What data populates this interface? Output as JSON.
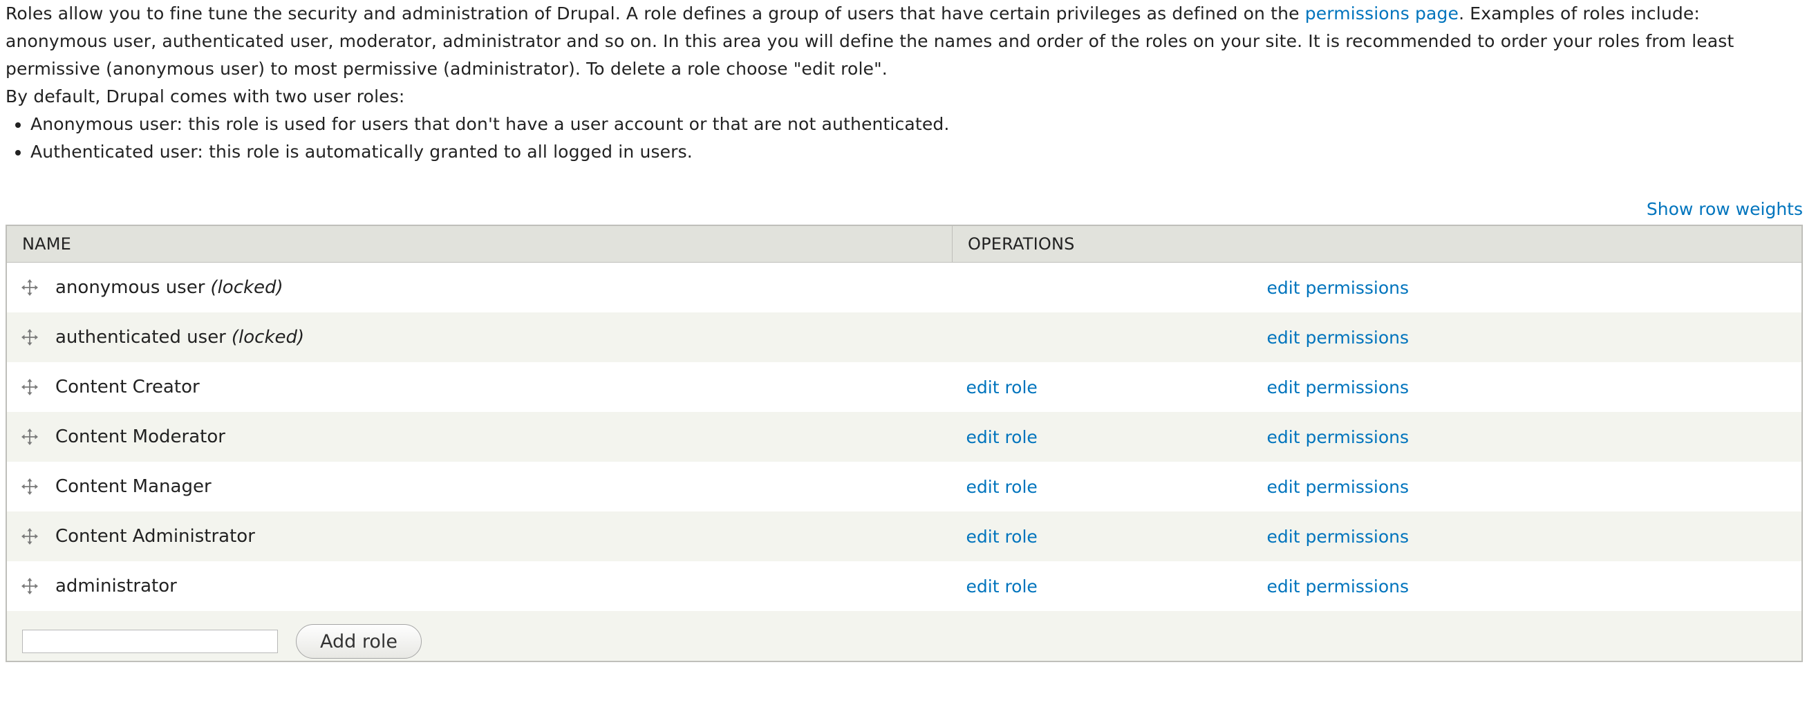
{
  "intro": {
    "text_before_link": "Roles allow you to fine tune the security and administration of Drupal. A role defines a group of users that have certain privileges as defined on the ",
    "link_text": "permissions page",
    "text_after_link": ". Examples of roles include: anonymous user, authenticated user, moderator, administrator and so on. In this area you will define the names and order of the roles on your site. It is recommended to order your roles from least permissive (anonymous user) to most permissive (administrator). To delete a role choose \"edit role\".",
    "defaults_heading": "By default, Drupal comes with two user roles:",
    "defaults": [
      "Anonymous user: this role is used for users that don't have a user account or that are not authenticated.",
      "Authenticated user: this role is automatically granted to all logged in users."
    ]
  },
  "table": {
    "show_row_weights": "Show row weights",
    "columns": [
      "NAME",
      "OPERATIONS"
    ],
    "rows": [
      {
        "name": "anonymous user",
        "locked": "(locked)",
        "edit_role": "",
        "edit_permissions": "edit permissions"
      },
      {
        "name": "authenticated user",
        "locked": "(locked)",
        "edit_role": "",
        "edit_permissions": "edit permissions"
      },
      {
        "name": "Content Creator",
        "locked": "",
        "edit_role": "edit role",
        "edit_permissions": "edit permissions"
      },
      {
        "name": "Content Moderator",
        "locked": "",
        "edit_role": "edit role",
        "edit_permissions": "edit permissions"
      },
      {
        "name": "Content Manager",
        "locked": "",
        "edit_role": "edit role",
        "edit_permissions": "edit permissions"
      },
      {
        "name": "Content Administrator",
        "locked": "",
        "edit_role": "edit role",
        "edit_permissions": "edit permissions"
      },
      {
        "name": "administrator",
        "locked": "",
        "edit_role": "edit role",
        "edit_permissions": "edit permissions"
      }
    ],
    "add_role": {
      "input_value": "",
      "button_label": "Add role"
    }
  },
  "colors": {
    "link": "#0074bd",
    "header_bg": "#e1e2dc",
    "even_row_bg": "#f3f4ee",
    "border": "#bfbfba"
  },
  "icons": {
    "drag_handle": "drag-handle-icon"
  }
}
